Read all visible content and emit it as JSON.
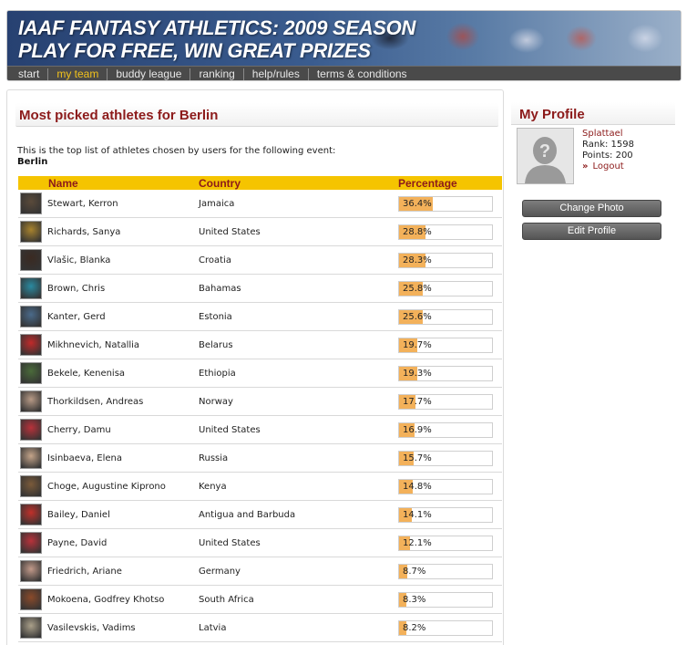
{
  "header": {
    "title_line1": "IAAF FANTASY ATHLETICS: 2009 SEASON",
    "title_line2": "PLAY FOR FREE, WIN GREAT PRIZES",
    "nav": [
      {
        "label": "start",
        "active": false
      },
      {
        "label": "my team",
        "active": true
      },
      {
        "label": "buddy league",
        "active": false
      },
      {
        "label": "ranking",
        "active": false
      },
      {
        "label": "help/rules",
        "active": false
      },
      {
        "label": "terms & conditions",
        "active": false
      }
    ],
    "active_color": "#f2c21b"
  },
  "main": {
    "title": "Most picked athletes for Berlin",
    "intro": "This is the top list of athletes chosen by users for the following event:",
    "event": "Berlin",
    "table": {
      "headers": {
        "name": "Name",
        "country": "Country",
        "percentage": "Percentage"
      },
      "rows": [
        {
          "name": "Stewart, Kerron",
          "country": "Jamaica",
          "pct": "36.4%",
          "value": 36.4,
          "thumb": "#5a4a3a"
        },
        {
          "name": "Richards, Sanya",
          "country": "United States",
          "pct": "28.8%",
          "value": 28.8,
          "thumb": "#a8832e"
        },
        {
          "name": "Vlašic, Blanka",
          "country": "Croatia",
          "pct": "28.3%",
          "value": 28.3,
          "thumb": "#3a2a22"
        },
        {
          "name": "Brown, Chris",
          "country": "Bahamas",
          "pct": "25.8%",
          "value": 25.8,
          "thumb": "#2a8aa0"
        },
        {
          "name": "Kanter, Gerd",
          "country": "Estonia",
          "pct": "25.6%",
          "value": 25.6,
          "thumb": "#4a6a8a"
        },
        {
          "name": "Mikhnevich, Natallia",
          "country": "Belarus",
          "pct": "19.7%",
          "value": 19.7,
          "thumb": "#c02a2a"
        },
        {
          "name": "Bekele, Kenenisa",
          "country": "Ethiopia",
          "pct": "19.3%",
          "value": 19.3,
          "thumb": "#4a6a3a"
        },
        {
          "name": "Thorkildsen, Andreas",
          "country": "Norway",
          "pct": "17.7%",
          "value": 17.7,
          "thumb": "#b79a86"
        },
        {
          "name": "Cherry, Damu",
          "country": "United States",
          "pct": "16.9%",
          "value": 16.9,
          "thumb": "#b8323a"
        },
        {
          "name": "Isinbaeva, Elena",
          "country": "Russia",
          "pct": "15.7%",
          "value": 15.7,
          "thumb": "#c4a48a"
        },
        {
          "name": "Choge, Augustine Kiprono",
          "country": "Kenya",
          "pct": "14.8%",
          "value": 14.8,
          "thumb": "#7a5a3a"
        },
        {
          "name": "Bailey, Daniel",
          "country": "Antigua and Barbuda",
          "pct": "14.1%",
          "value": 14.1,
          "thumb": "#c0302a"
        },
        {
          "name": "Payne, David",
          "country": "United States",
          "pct": "12.1%",
          "value": 12.1,
          "thumb": "#b8323a"
        },
        {
          "name": "Friedrich, Ariane",
          "country": "Germany",
          "pct": "8.7%",
          "value": 8.7,
          "thumb": "#c29a8a"
        },
        {
          "name": "Mokoena, Godfrey Khotso",
          "country": "South Africa",
          "pct": "8.3%",
          "value": 8.3,
          "thumb": "#8a4a2a"
        },
        {
          "name": "Vasilevskis, Vadims",
          "country": "Latvia",
          "pct": "8.2%",
          "value": 8.2,
          "thumb": "#aaa08a"
        }
      ]
    },
    "bar_color": "#f3b15a",
    "header_color": "#f5c400"
  },
  "profile": {
    "title": "My Profile",
    "username": "Splattael",
    "rank": "Rank: 1598",
    "points": "Points: 200",
    "logout": "Logout",
    "change_photo": "Change Photo",
    "edit_profile": "Edit Profile"
  }
}
